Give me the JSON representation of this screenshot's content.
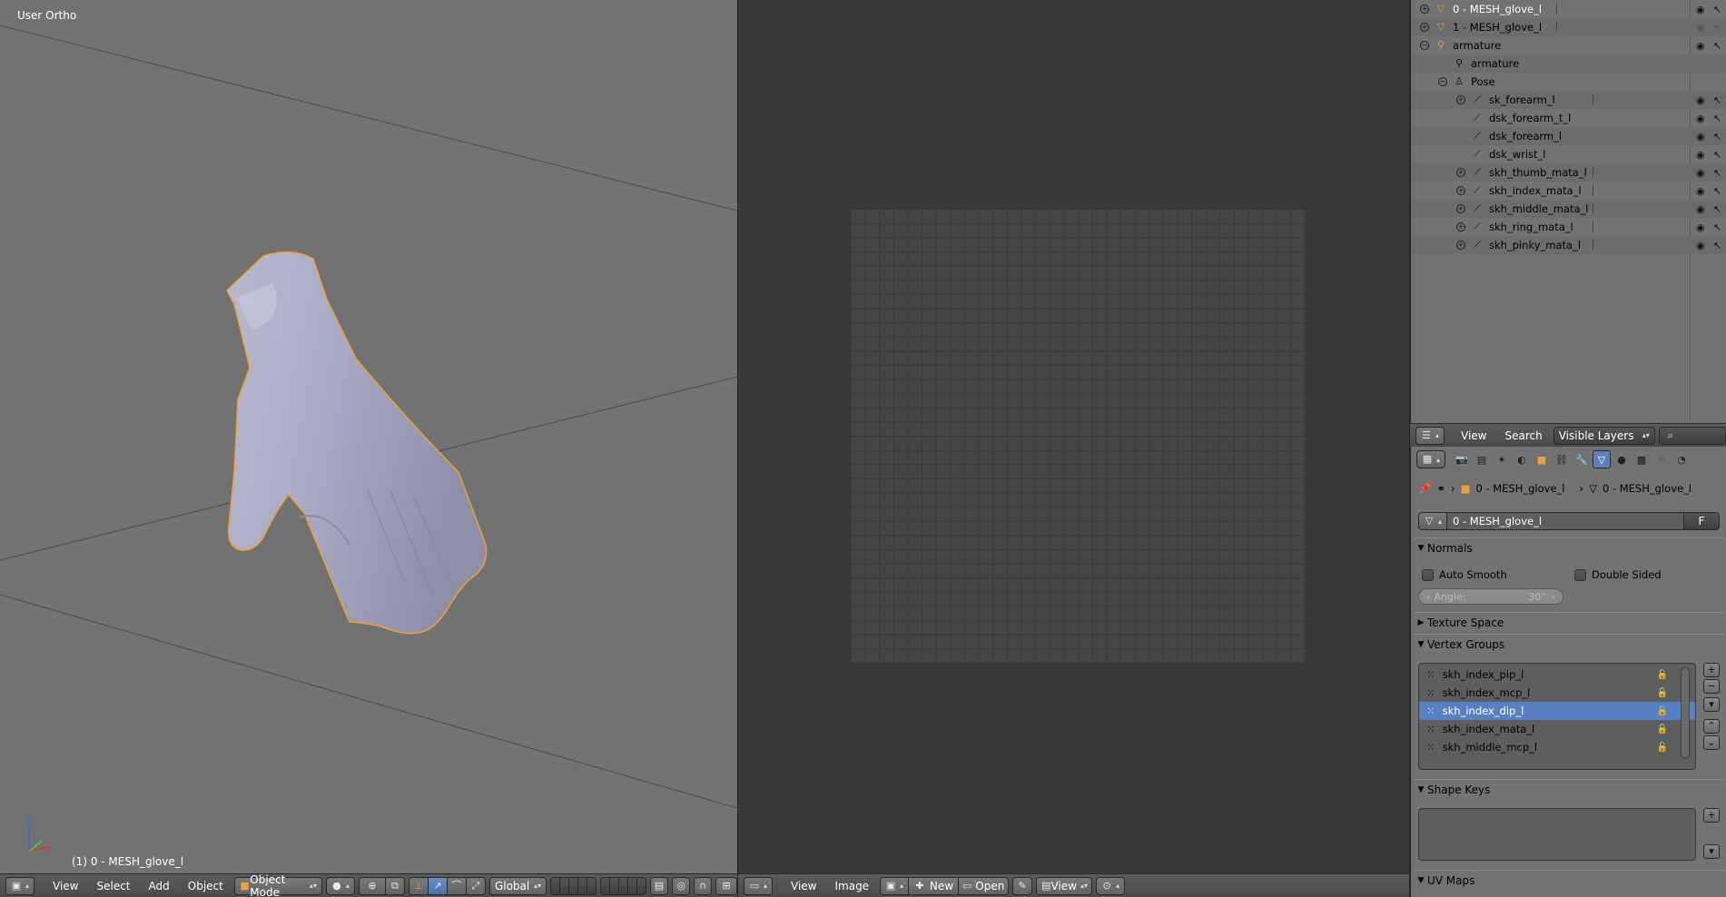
{
  "viewport3d": {
    "view_label": "User Ortho",
    "object_label": "(1) 0 - MESH_glove_l",
    "header": {
      "menus": [
        "View",
        "Select",
        "Add",
        "Object"
      ],
      "mode": "Object Mode",
      "orientation": "Global"
    }
  },
  "image_editor": {
    "header": {
      "menus": [
        "View",
        "Image"
      ],
      "new_label": "New",
      "open_label": "Open",
      "view_label": "View"
    }
  },
  "outliner": {
    "rows": [
      {
        "name": "0 - MESH_glove_l",
        "icon": "mesh-icon",
        "indent": 0,
        "expander": true
      },
      {
        "name": "1 - MESH_glove_l",
        "icon": "mesh-icon",
        "indent": 0,
        "expander": true
      },
      {
        "name": "armature",
        "icon": "armature-icon",
        "indent": 0,
        "expander": true
      },
      {
        "name": "armature",
        "icon": "armature-data-icon",
        "indent": 1,
        "expander": false
      },
      {
        "name": "Pose",
        "icon": "pose-icon",
        "indent": 1,
        "expander": true
      },
      {
        "name": "sk_forearm_l",
        "icon": "bone-icon",
        "indent": 2,
        "expander": true
      },
      {
        "name": "dsk_forearm_t_l",
        "icon": "bone-icon",
        "indent": 2,
        "expander": false
      },
      {
        "name": "dsk_forearm_l",
        "icon": "bone-icon",
        "indent": 2,
        "expander": false
      },
      {
        "name": "dsk_wrist_l",
        "icon": "bone-icon",
        "indent": 2,
        "expander": false
      },
      {
        "name": "skh_thumb_mata_l",
        "icon": "bone-icon",
        "indent": 2,
        "expander": true
      },
      {
        "name": "skh_index_mata_l",
        "icon": "bone-icon",
        "indent": 2,
        "expander": true
      },
      {
        "name": "skh_middle_mata_l",
        "icon": "bone-icon",
        "indent": 2,
        "expander": true
      },
      {
        "name": "skh_ring_mata_l",
        "icon": "bone-icon",
        "indent": 2,
        "expander": true
      },
      {
        "name": "skh_pinky_mata_l",
        "icon": "bone-icon",
        "indent": 2,
        "expander": true
      }
    ],
    "header": {
      "menus": [
        "View",
        "Search"
      ],
      "filter": "Visible Layers"
    }
  },
  "properties": {
    "breadcrumb": {
      "object": "0 - MESH_glove_l",
      "data": "0 - MESH_glove_l"
    },
    "datablock_name": "0 - MESH_glove_l",
    "fake_user": "F",
    "normals": {
      "title": "Normals",
      "auto_smooth": "Auto Smooth",
      "double_sided": "Double Sided",
      "angle_label": "Angle:",
      "angle_value": "30°"
    },
    "texture_space": "Texture Space",
    "vertex_groups": {
      "title": "Vertex Groups",
      "items": [
        "skh_index_pip_l",
        "skh_index_mcp_l",
        "skh_index_dip_l",
        "skh_index_mata_l",
        "skh_middle_mcp_l"
      ],
      "selected_index": 2
    },
    "shape_keys": "Shape Keys",
    "uv_maps": "UV Maps"
  },
  "colors": {
    "viewport_bg": "#727272",
    "editor_bg": "#393939",
    "selection_blue": "#5680c2",
    "mesh_outline": "#f0a030"
  }
}
